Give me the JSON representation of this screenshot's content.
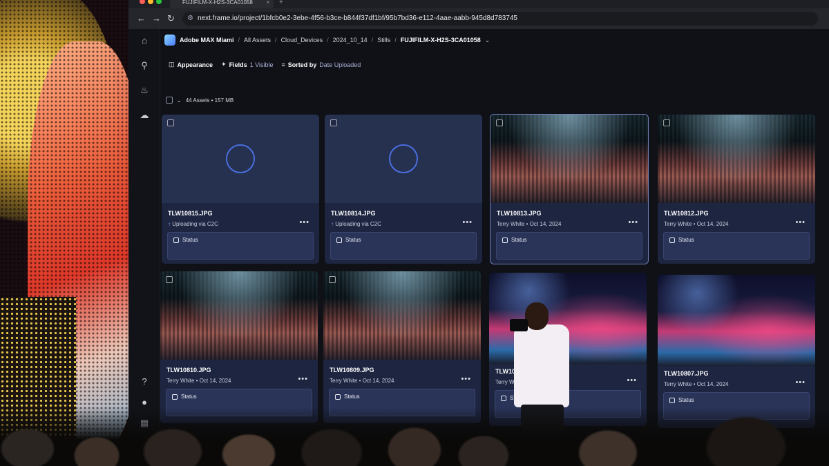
{
  "browser": {
    "tab_title": "FUJIFILM-X-H2S-3CA01058",
    "tab_close": "×",
    "new_tab": "+",
    "url": "next.frame.io/project/1bfcb0e2-3ebe-4f56-b3ce-b844f37df1bf/95b7bd36-e112-4aae-aabb-945d8d783745"
  },
  "breadcrumb": {
    "project": "Adobe MAX Miami",
    "items": [
      "All Assets",
      "Cloud_Devices",
      "2024_10_14",
      "Stills"
    ],
    "current": "FUJIFILM-X-H2S-3CA01058"
  },
  "toolbar": {
    "appearance": "Appearance",
    "fields": "Fields",
    "fields_value": "1 Visible",
    "sorted": "Sorted by",
    "sorted_value": "Date Uploaded"
  },
  "assets_summary": "44 Assets • 157 MB",
  "sidebar_icons": [
    "home-icon",
    "search-icon",
    "bell-icon",
    "cloud-upload-icon",
    "help-icon",
    "lightbulb-icon",
    "grid-icon"
  ],
  "cards": [
    {
      "name": "TLW10815.JPG",
      "meta": "Uploading via C2C",
      "uploading": true,
      "status": "Status"
    },
    {
      "name": "TLW10814.JPG",
      "meta": "Uploading via C2C",
      "uploading": true,
      "status": "Status"
    },
    {
      "name": "TLW10813.JPG",
      "meta": "Terry White • Oct 14, 2024",
      "uploading": false,
      "status": "Status"
    },
    {
      "name": "TLW10812.JPG",
      "meta": "Terry White • Oct 14, 2024",
      "uploading": false,
      "status": "Status"
    },
    {
      "name": "TLW10810.JPG",
      "meta": "Terry White • Oct 14, 2024",
      "uploading": false,
      "status": "Status"
    },
    {
      "name": "TLW10809.JPG",
      "meta": "Terry White • Oct 14, 2024",
      "uploading": false,
      "status": "Status"
    },
    {
      "name": "TLW1080",
      "meta": "Terry Whi",
      "uploading": false,
      "status": "Statu"
    },
    {
      "name": "TLW10807.JPG",
      "meta": "Terry White • Oct 14, 2024",
      "uploading": false,
      "status": "Status"
    }
  ],
  "colors": {
    "accent": "#4a6fe0",
    "card_bg": "#1d2540",
    "upload_text": "#7fb3ff"
  }
}
